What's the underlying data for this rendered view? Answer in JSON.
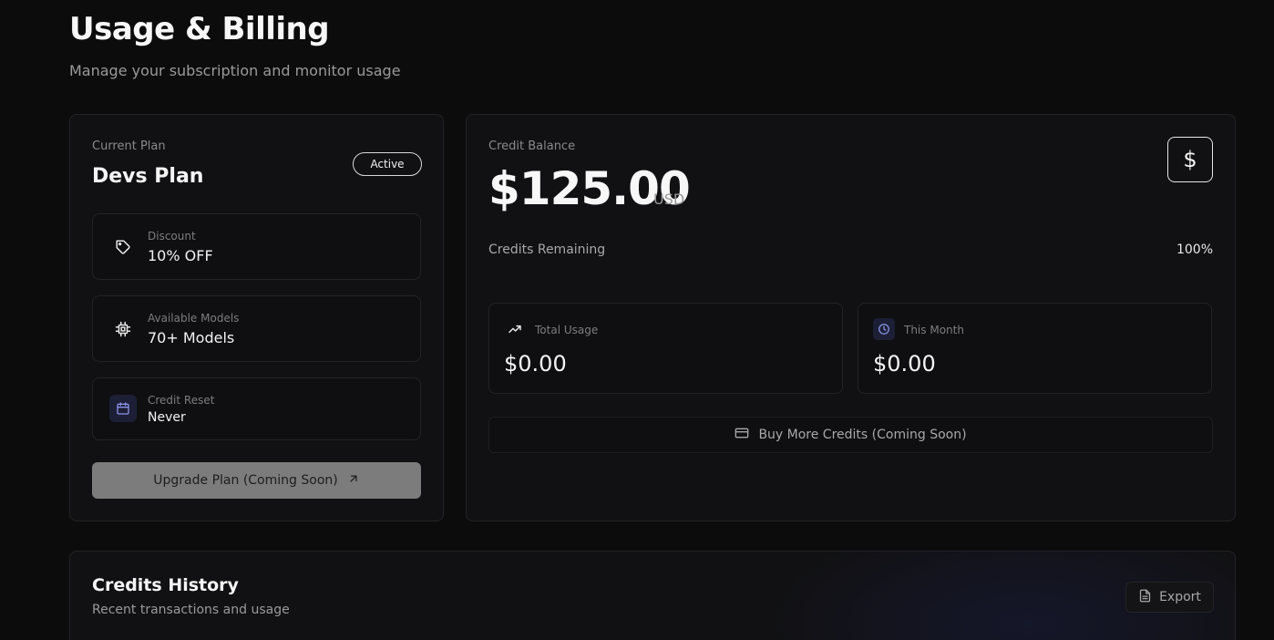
{
  "header": {
    "title": "Usage & Billing",
    "subtitle": "Manage your subscription and monitor usage"
  },
  "plan": {
    "label": "Current Plan",
    "name": "Devs Plan",
    "status_badge": "Active",
    "features": [
      {
        "icon": "tag-icon",
        "label": "Discount",
        "value": "10% OFF"
      },
      {
        "icon": "cpu-chip-icon",
        "label": "Available Models",
        "value": "70+ Models"
      },
      {
        "icon": "calendar-icon",
        "label": "Credit Reset",
        "value": "Never"
      }
    ],
    "upgrade_label": "Upgrade Plan (Coming Soon)"
  },
  "balance": {
    "label": "Credit Balance",
    "amount": "$125.00",
    "currency": "USD",
    "icon": "dollar-icon",
    "remaining_label": "Credits Remaining",
    "remaining_percent": "100%",
    "stats": [
      {
        "icon": "trending-up-icon",
        "label": "Total Usage",
        "value": "$0.00"
      },
      {
        "icon": "clock-icon",
        "label": "This Month",
        "value": "$0.00"
      }
    ],
    "buy_label": "Buy More Credits (Coming Soon)"
  },
  "history": {
    "title": "Credits History",
    "subtitle": "Recent transactions and usage",
    "export_label": "Export"
  },
  "colors": {
    "background": "#0c0c0d",
    "card": "#111113",
    "accent_icon_bg": "#1c1f35",
    "accent_icon": "#8b93e8"
  }
}
